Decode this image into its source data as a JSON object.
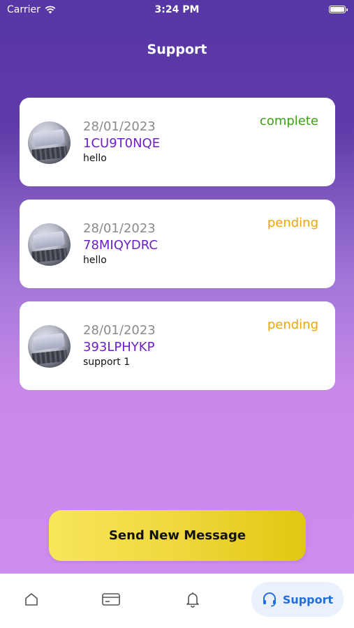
{
  "status_bar": {
    "carrier": "Carrier",
    "time": "3:24 PM"
  },
  "header": {
    "title": "Support"
  },
  "tickets": [
    {
      "date": "28/01/2023",
      "id": "1CU9T0NQE",
      "message": "hello",
      "status": "complete",
      "status_color": "#3aa20e"
    },
    {
      "date": "28/01/2023",
      "id": "78MIQYDRC",
      "message": "hello",
      "status": "pending",
      "status_color": "#f0a500"
    },
    {
      "date": "28/01/2023",
      "id": "393LPHYKP",
      "message": "support 1",
      "status": "pending",
      "status_color": "#f0a500"
    }
  ],
  "actions": {
    "send_label": "Send New Message"
  },
  "tab_bar": {
    "items": [
      {
        "icon": "home-icon"
      },
      {
        "icon": "card-icon"
      },
      {
        "icon": "bell-icon"
      },
      {
        "icon": "headset-icon",
        "label": "Support",
        "active": true
      }
    ]
  },
  "colors": {
    "accent": "#6b1fc4",
    "tab_active": "#1f6fe0",
    "button": "#eed63a"
  }
}
